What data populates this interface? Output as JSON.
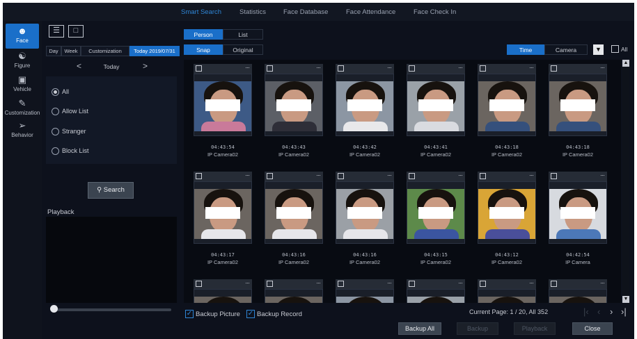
{
  "topnav": {
    "tabs": [
      "Smart Search",
      "Statistics",
      "Face Database",
      "Face Attendance",
      "Face Check In"
    ],
    "active": 0
  },
  "rail": [
    {
      "label": "Face",
      "icon": "face-icon",
      "active": true
    },
    {
      "label": "Figure",
      "icon": "figure-icon",
      "active": false
    },
    {
      "label": "Vehicle",
      "icon": "vehicle-icon",
      "active": false
    },
    {
      "label": "Customization",
      "icon": "customization-icon",
      "active": false
    },
    {
      "label": "Behavior",
      "icon": "behavior-icon",
      "active": false
    }
  ],
  "panel": {
    "date_tabs": [
      "Day",
      "Week",
      "Customization",
      "Today 2019/07/31"
    ],
    "day_nav": {
      "prev": "<",
      "label": "Today",
      "next": ">"
    },
    "radio": [
      "All",
      "Allow List",
      "Stranger",
      "Block List"
    ],
    "radio_selected": 0,
    "search_label": "Search",
    "playback_label": "Playback",
    "playback_progress": 0
  },
  "main": {
    "mode_tabs": [
      "Person",
      "List"
    ],
    "mode_active": 0,
    "image_tabs": [
      "Snap",
      "Original"
    ],
    "image_active": 0,
    "sort_tabs": [
      "Time",
      "Camera"
    ],
    "sort_active": 0,
    "all_label": "All",
    "results": [
      {
        "time": "04:43:54",
        "camera": "IP Camera02"
      },
      {
        "time": "04:43:43",
        "camera": "IP Camera02"
      },
      {
        "time": "04:43:42",
        "camera": "IP Camera02"
      },
      {
        "time": "04:43:41",
        "camera": "IP Camera02"
      },
      {
        "time": "04:43:18",
        "camera": "IP Camera02"
      },
      {
        "time": "04:43:18",
        "camera": "IP Camera02"
      },
      {
        "time": "04:43:17",
        "camera": "IP Camera02"
      },
      {
        "time": "04:43:16",
        "camera": "IP Camera02"
      },
      {
        "time": "04:43:16",
        "camera": "IP Camera02"
      },
      {
        "time": "04:43:15",
        "camera": "IP Camera02"
      },
      {
        "time": "04:43:12",
        "camera": "IP Camera02"
      },
      {
        "time": "04:42:54",
        "camera": "IP Camera"
      },
      {
        "time": "",
        "camera": ""
      },
      {
        "time": "",
        "camera": ""
      },
      {
        "time": "",
        "camera": ""
      },
      {
        "time": "",
        "camera": ""
      },
      {
        "time": "",
        "camera": ""
      },
      {
        "time": "",
        "camera": ""
      }
    ],
    "backup_picture_label": "Backup Picture",
    "backup_record_label": "Backup Record",
    "page_info": "Current Page: 1 / 20, All 352",
    "buttons": {
      "backup_all": "Backup All",
      "backup": "Backup",
      "playback": "Playback",
      "close": "Close"
    }
  },
  "colors": {
    "accent": "#1a6fc9",
    "background": "#0d111c",
    "nav_active": "#2f86d6"
  }
}
